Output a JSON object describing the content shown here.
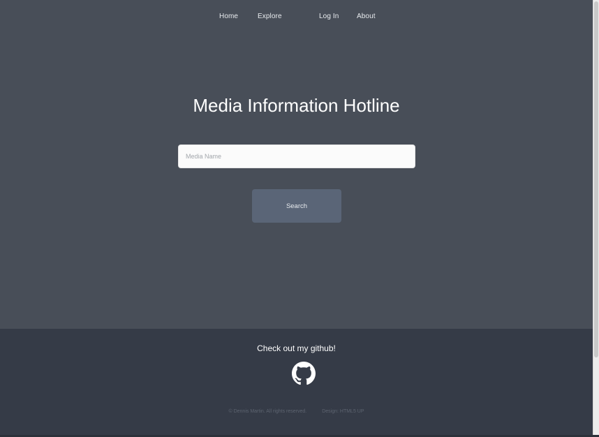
{
  "nav": {
    "home": "Home",
    "explore": "Explore",
    "login": "Log In",
    "about": "About"
  },
  "hero": {
    "title": "Media Information Hotline",
    "search_placeholder": "Media Name",
    "search_button": "Search"
  },
  "footer": {
    "cta": "Check out my github!",
    "github_icon": "github-icon",
    "copyright": "© Dennis Martin. All rights reserved.",
    "design_credit": "Design: HTML5 UP"
  },
  "colors": {
    "page_bg": "#484e58",
    "footer_bg": "#353b47",
    "button_bg": "#5a6577"
  }
}
